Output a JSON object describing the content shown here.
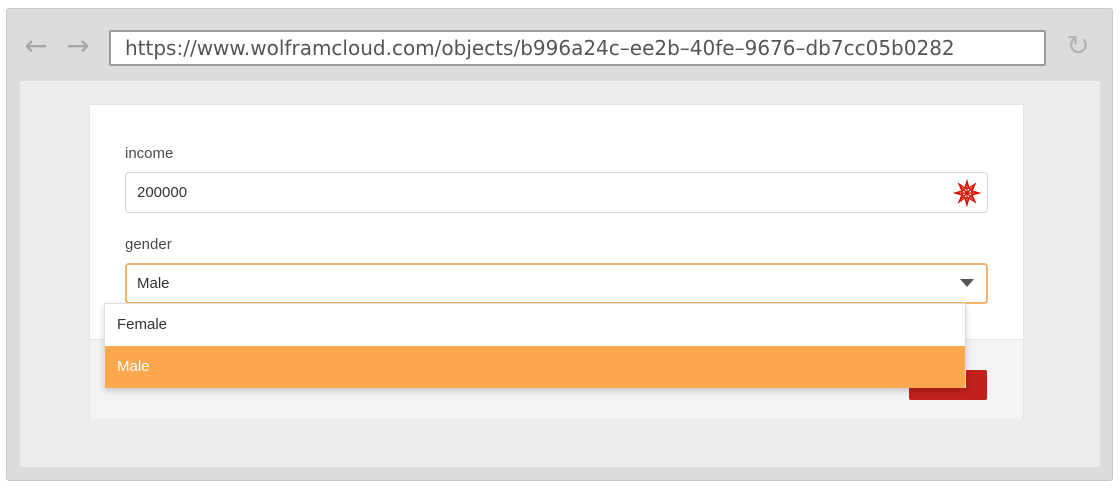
{
  "browser": {
    "back_icon": "left-arrow-icon",
    "forward_icon": "right-arrow-icon",
    "reload_icon": "reload-icon",
    "url": "https://www.wolframcloud.com/objects/b996a24c–ee2b–40fe–9676–db7cc05b0282"
  },
  "form": {
    "income": {
      "label": "income",
      "value": "200000",
      "icon": "wolfram-spikey-icon"
    },
    "gender": {
      "label": "gender",
      "selected": "Male",
      "icon": "chevron-down-icon",
      "options": [
        "Female",
        "Male"
      ],
      "highlighted": "Male"
    },
    "submit_color": "#c0211d"
  },
  "colors": {
    "accent": "#faa74e",
    "focus_border": "#f4b36a",
    "wolfram_red": "#dd1100"
  }
}
